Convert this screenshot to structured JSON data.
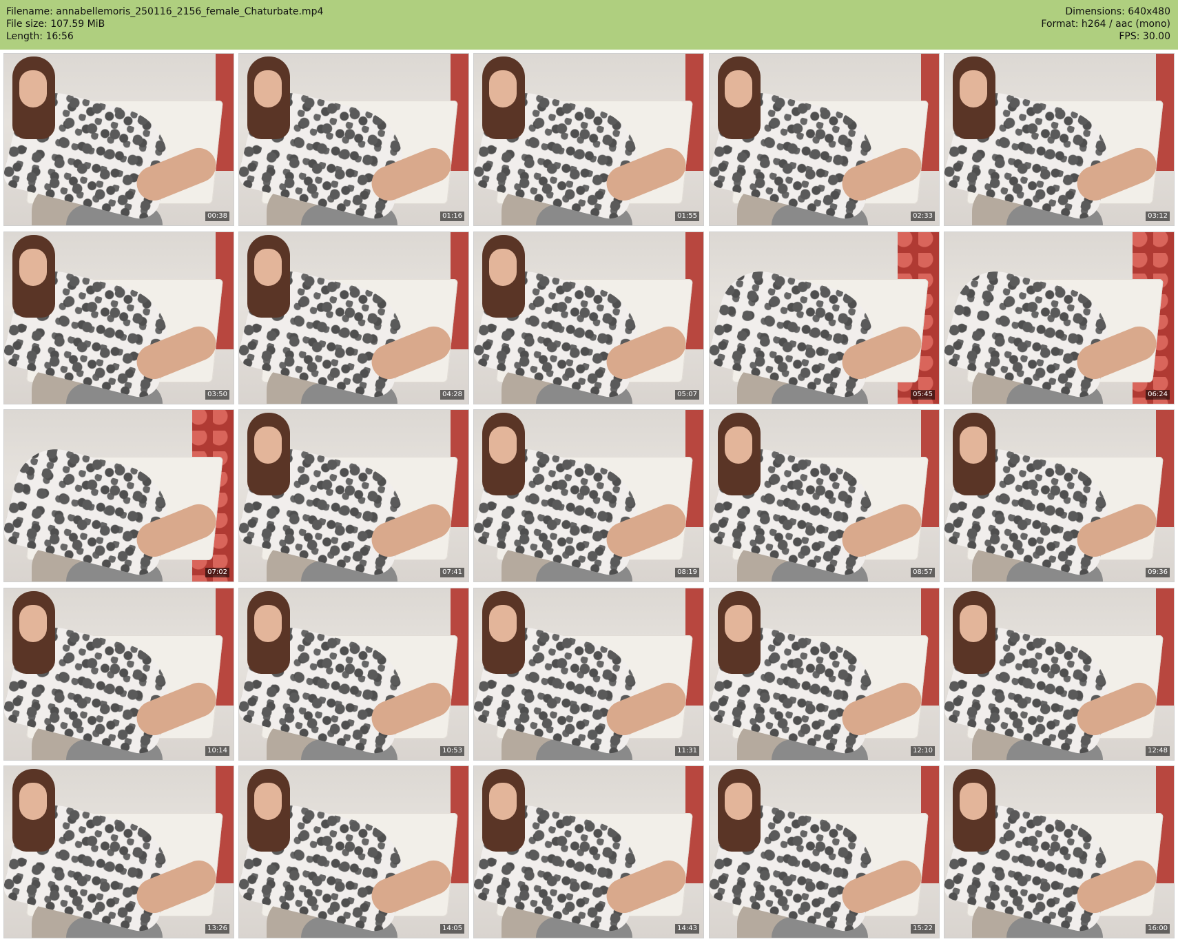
{
  "header": {
    "filename_line": "Filename: annabellemoris_250116_2156_female_Chaturbate.mp4",
    "filesize_line": "File size: 107.59 MiB",
    "length_line": "Length: 16:56",
    "dimensions_line": "Dimensions: 640x480",
    "format_line": "Format: h264 / aac (mono)",
    "fps_line": "FPS: 30.00"
  },
  "thumbnails": [
    {
      "time": "00:38"
    },
    {
      "time": "01:16"
    },
    {
      "time": "01:55"
    },
    {
      "time": "02:33"
    },
    {
      "time": "03:12"
    },
    {
      "time": "03:50"
    },
    {
      "time": "04:28"
    },
    {
      "time": "05:07"
    },
    {
      "time": "05:45"
    },
    {
      "time": "06:24"
    },
    {
      "time": "07:02"
    },
    {
      "time": "07:41"
    },
    {
      "time": "08:19"
    },
    {
      "time": "08:57"
    },
    {
      "time": "09:36"
    },
    {
      "time": "10:14"
    },
    {
      "time": "10:53"
    },
    {
      "time": "11:31"
    },
    {
      "time": "12:10"
    },
    {
      "time": "12:48"
    },
    {
      "time": "13:26"
    },
    {
      "time": "14:05"
    },
    {
      "time": "14:43"
    },
    {
      "time": "15:22"
    },
    {
      "time": "16:00"
    }
  ],
  "colors": {
    "header_bg": "#afcf7f",
    "accent_red": "#b8473f"
  }
}
